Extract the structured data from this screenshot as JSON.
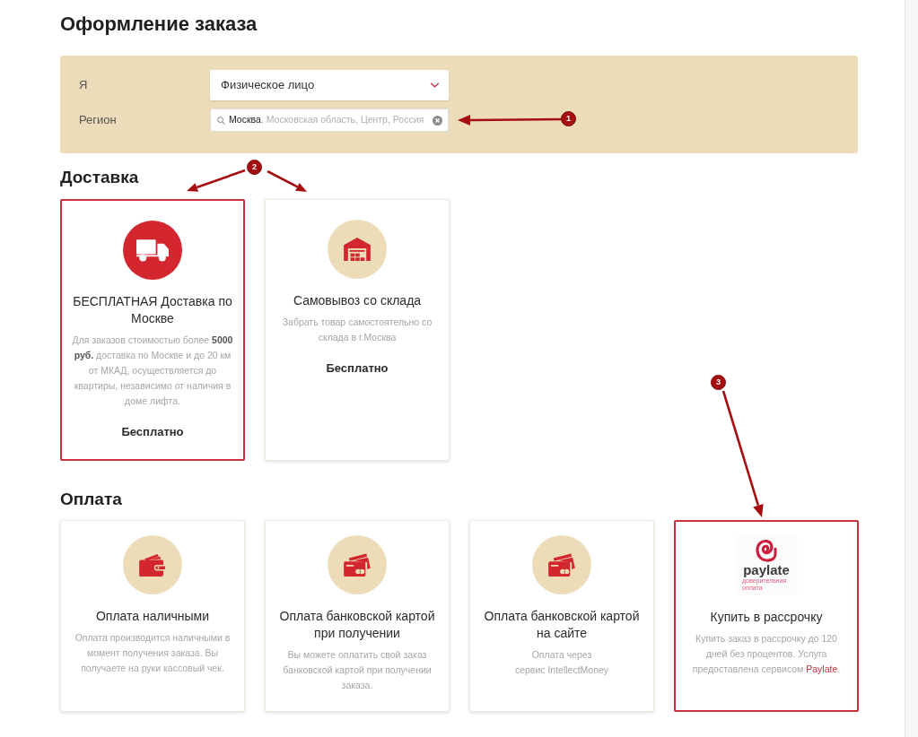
{
  "page": {
    "title": "Оформление заказа"
  },
  "customer": {
    "fields": [
      {
        "kind": "select",
        "label": "Я",
        "value": "Физическое лицо"
      },
      {
        "kind": "search",
        "label": "Регион",
        "value": "Москва",
        "hint": ", Московская область, Центр, Россия"
      }
    ]
  },
  "delivery": {
    "title": "Доставка",
    "options": [
      {
        "kind": "truck",
        "selected": true,
        "title": "БЕСПЛАТНАЯ Доставка по Москве",
        "description": "Для заказов стоимостью более **5000 руб.** доставка по Москве и до 20 км от МКАД, осуществляется до квартиры, независимо от наличия в доме лифта.",
        "price": "Бесплатно"
      },
      {
        "kind": "warehouse",
        "selected": false,
        "title": "Самовывоз со склада",
        "description": "Забрать товар самостоятельно со склада в г.Москва",
        "price": "Бесплатно"
      }
    ]
  },
  "payment": {
    "title": "Оплата",
    "options": [
      {
        "kind": "wallet",
        "selected": false,
        "title": "Оплата наличными",
        "description": "Оплата производится наличными в момент получения заказа. Вы получаете на руки кассовый чек."
      },
      {
        "kind": "card",
        "selected": false,
        "title": "Оплата банковской картой при получении",
        "description": "Вы можете оплатить свой заказ банковской картой при получении заказа."
      },
      {
        "kind": "card",
        "selected": false,
        "title": "Оплата банковской картой на сайте",
        "description": "Оплата через\nсервис IntellectMoney"
      },
      {
        "kind": "logo",
        "selected": true,
        "logo": {
          "name": "paylate",
          "tagline": "доверительная оплата"
        },
        "title": "Купить в рассрочку",
        "description": "Купить заказ в рассрочку до 120 дней без процентов. Услуга предоставлена сервисом",
        "link": "Paylate",
        "after_link": "."
      }
    ]
  },
  "annotations": [
    {
      "label": "1"
    },
    {
      "label": "2"
    },
    {
      "label": "3"
    }
  ]
}
